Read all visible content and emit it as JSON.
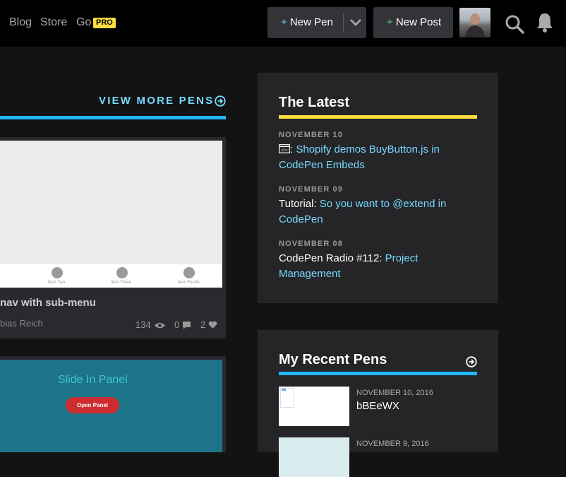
{
  "topbar": {
    "links": [
      {
        "label": "Blog"
      },
      {
        "label": "Store"
      },
      {
        "label": "Go"
      }
    ],
    "pro_badge": "PRO",
    "new_pen": {
      "plus": "+",
      "label": "New Pen"
    },
    "new_post": {
      "plus": "+",
      "label": "New Post"
    },
    "icons": [
      "chevron-down-icon",
      "search-icon",
      "bell-icon"
    ]
  },
  "pens": {
    "view_more": "VIEW MORE PENS",
    "card1": {
      "preview_labels": [
        "Item Two",
        "Item Three",
        "Item Fourth"
      ],
      "title": "nav with sub-menu",
      "author": "bias Reich",
      "views": "134",
      "comments": "0",
      "likes": "2"
    },
    "card2": {
      "preview_title": "Slide In Panel",
      "preview_button": "Open Panel"
    }
  },
  "latest": {
    "title": "The Latest",
    "entries": [
      {
        "date": "NOVEMBER 10",
        "prefix": ": ",
        "link": "Shopify demos BuyButton.js in CodePen Embeds"
      },
      {
        "date": "NOVEMBER 09",
        "prefix": "Tutorial: ",
        "link": "So you want to @extend in CodePen"
      },
      {
        "date": "NOVEMBER 08",
        "prefix": "CodePen Radio #112: ",
        "link": "Project Management"
      }
    ]
  },
  "recent_pens": {
    "title": "My Recent Pens",
    "items": [
      {
        "date": "NOVEMBER 10, 2016",
        "name": "bBEeWX"
      },
      {
        "date": "NOVEMBER 9, 2016",
        "name": ""
      }
    ]
  },
  "colors": {
    "accent_blue": "#76daff",
    "bar_blue": "#1fb6ff",
    "yellow": "#ffdd40",
    "green": "#47cf73"
  }
}
